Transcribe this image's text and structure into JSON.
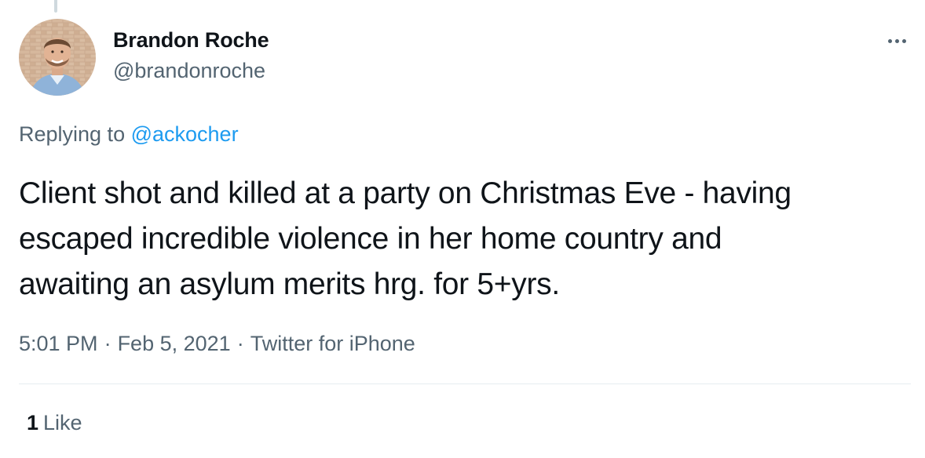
{
  "author": {
    "display_name": "Brandon Roche",
    "handle": "@brandonroche",
    "avatar_icon": "profile-photo"
  },
  "reply": {
    "prefix": "Replying to ",
    "mention": "@ackocher"
  },
  "tweet": {
    "lines": [
      "Client shot and killed at a party on Christmas Eve - having",
      "escaped incredible violence in her home country and",
      "awaiting an asylum merits hrg. for 5+yrs."
    ]
  },
  "meta": {
    "time": "5:01 PM",
    "separator": "·",
    "date": "Feb 5, 2021",
    "source": "Twitter for iPhone"
  },
  "engagement": {
    "like_count": "1",
    "like_label": "Like"
  },
  "menu": {
    "more_icon": "more-horizontal-icon"
  },
  "colors": {
    "primary_text": "#0f1419",
    "secondary_text": "#536471",
    "link": "#1d9bf0",
    "divider": "#e6ecf0"
  }
}
